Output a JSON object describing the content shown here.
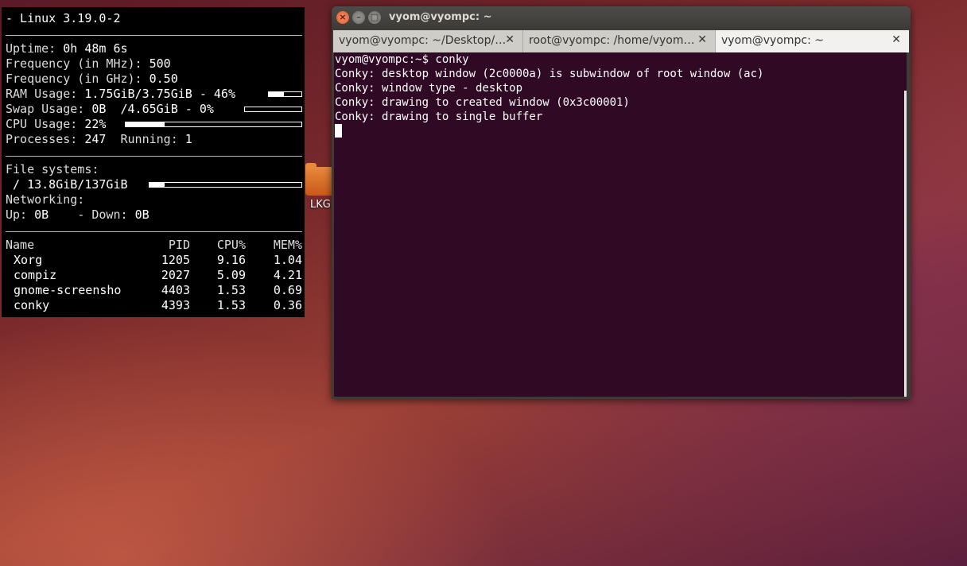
{
  "desktop": {
    "icon_label": "LKG"
  },
  "conky": {
    "header": "- Linux 3.19.0-2",
    "uptime_label": "Uptime:",
    "uptime": "0h 48m 6s",
    "freq_mhz_label": "Frequency (in MHz):",
    "freq_mhz": "500",
    "freq_ghz_label": "Frequency (in GHz):",
    "freq_ghz": "0.50",
    "ram_label": "RAM Usage:",
    "ram": "1.75GiB/3.75GiB - 46%",
    "ram_pct": 46,
    "swap_label": "Swap Usage:",
    "swap": "0B  /4.65GiB - 0%",
    "swap_pct": 0,
    "cpu_label": "CPU Usage:",
    "cpu": "22%",
    "cpu_pct": 22,
    "proc_label": "Processes:",
    "processes": "247",
    "running_label": "Running:",
    "running": "1",
    "fs_label": "File systems:",
    "fs": " / 13.8GiB/137GiB",
    "fs_pct": 10,
    "net_label": "Networking:",
    "up_label": "Up:",
    "up": "0B",
    "down_label": "- Down:",
    "down": "0B",
    "columns": {
      "name": "Name",
      "pid": "PID",
      "cpu": "CPU%",
      "mem": "MEM%"
    },
    "processes_list": [
      {
        "name": "Xorg",
        "pid": "1205",
        "cpu": "9.16",
        "mem": "1.04"
      },
      {
        "name": "compiz",
        "pid": "2027",
        "cpu": "5.09",
        "mem": "4.21"
      },
      {
        "name": "gnome-screensho",
        "pid": "4403",
        "cpu": "1.53",
        "mem": "0.69"
      },
      {
        "name": "conky",
        "pid": "4393",
        "cpu": "1.53",
        "mem": "0.36"
      }
    ]
  },
  "terminal": {
    "window_title": "vyom@vyompc: ~",
    "tabs": [
      {
        "label": "vyom@vyompc: ~/Desktop/…"
      },
      {
        "label": "root@vyompc: /home/vyom…"
      },
      {
        "label": "vyom@vyompc: ~"
      }
    ],
    "lines": [
      "vyom@vyompc:~$ conky",
      "Conky: desktop window (2c0000a) is subwindow of root window (ac)",
      "Conky: window type - desktop",
      "Conky: drawing to created window (0x3c00001)",
      "Conky: drawing to single buffer"
    ]
  },
  "colors": {
    "terminal_bg": "#300a24",
    "close_button": "#e0582a",
    "conky_bg": "#000000"
  }
}
